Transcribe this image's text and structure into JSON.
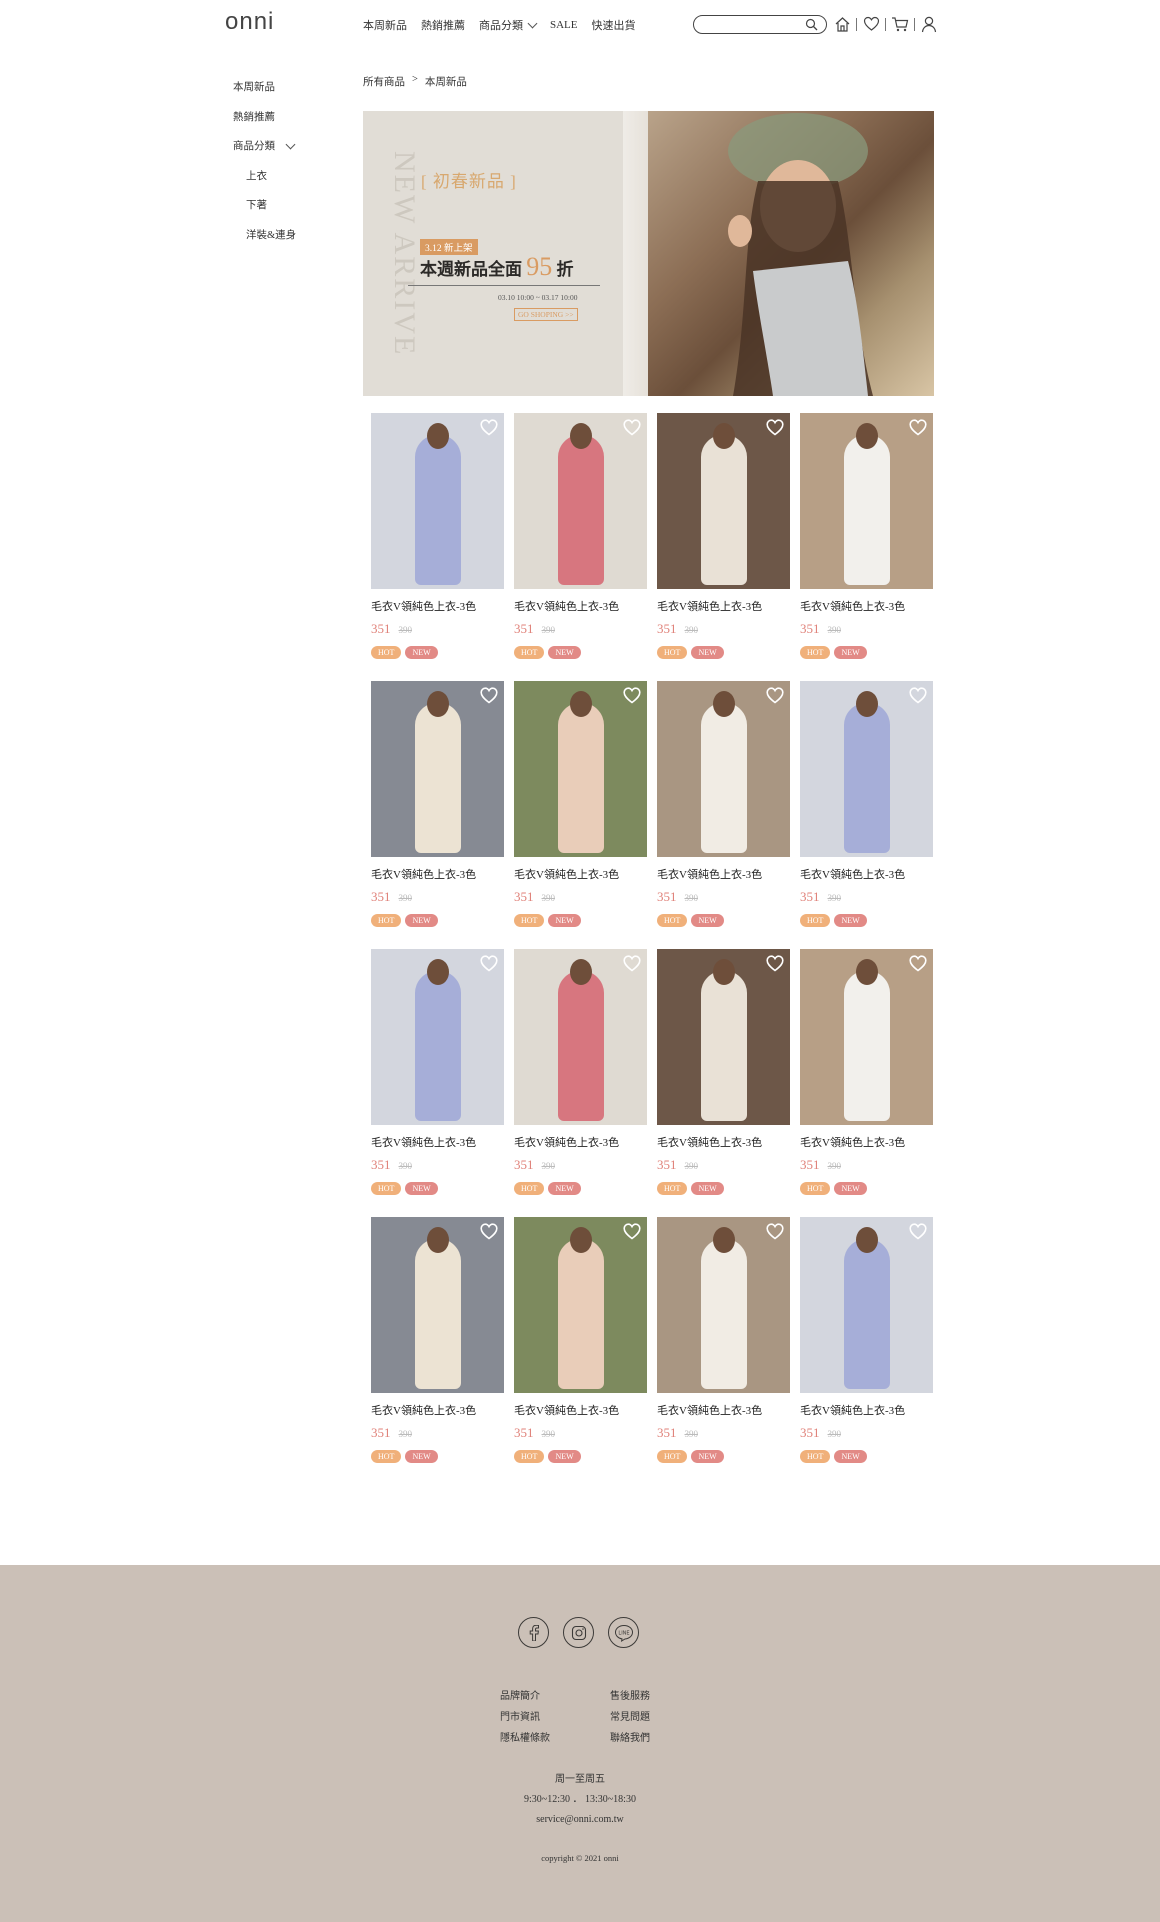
{
  "header": {
    "logo": "onni",
    "nav": [
      {
        "label": "本周新品",
        "dropdown": false
      },
      {
        "label": "熱銷推薦",
        "dropdown": false
      },
      {
        "label": "商品分類",
        "dropdown": true
      },
      {
        "label": "SALE",
        "dropdown": false
      },
      {
        "label": "快速出貨",
        "dropdown": false
      }
    ],
    "search_placeholder": "",
    "icons": [
      "home-icon",
      "heart-icon",
      "cart-icon",
      "user-icon"
    ]
  },
  "sidebar": {
    "items": [
      {
        "label": "本周新品",
        "sub": false
      },
      {
        "label": "熱銷推薦",
        "sub": false
      },
      {
        "label": "商品分類",
        "sub": false,
        "dropdown": true
      },
      {
        "label": "上衣",
        "sub": true
      },
      {
        "label": "下著",
        "sub": true
      },
      {
        "label": "洋裝&連身",
        "sub": true
      }
    ]
  },
  "breadcrumb": [
    "所有商品",
    ">",
    "本周新品"
  ],
  "banner": {
    "vertical_text": "NEW ARRIVE",
    "title": "[ 初春新品 ]",
    "tag": "3.12 新上架",
    "headline_pre": "本週新品全面",
    "headline_num": "95",
    "headline_post": "折",
    "dates": "03.10 10:00 ~ 03.17 10:00",
    "cta": "GO SHOPING >>"
  },
  "products": [
    {
      "name": "毛衣V領純色上衣-3色",
      "price": "351",
      "original": "390",
      "badges": [
        "HOT",
        "NEW"
      ],
      "bg": "#d3d6de",
      "dress": "#a6aed8"
    },
    {
      "name": "毛衣V領純色上衣-3色",
      "price": "351",
      "original": "390",
      "badges": [
        "HOT",
        "NEW"
      ],
      "bg": "#dfdad2",
      "dress": "#d7767f"
    },
    {
      "name": "毛衣V領純色上衣-3色",
      "price": "351",
      "original": "390",
      "badges": [
        "HOT",
        "NEW"
      ],
      "bg": "#6d5748",
      "dress": "#e9e1d6"
    },
    {
      "name": "毛衣V領純色上衣-3色",
      "price": "351",
      "original": "390",
      "badges": [
        "HOT",
        "NEW"
      ],
      "bg": "#b79f86",
      "dress": "#f2f0ec"
    },
    {
      "name": "毛衣V領純色上衣-3色",
      "price": "351",
      "original": "390",
      "badges": [
        "HOT",
        "NEW"
      ],
      "bg": "#868a93",
      "dress": "#ece3d3"
    },
    {
      "name": "毛衣V領純色上衣-3色",
      "price": "351",
      "original": "390",
      "badges": [
        "HOT",
        "NEW"
      ],
      "bg": "#7d8a5e",
      "dress": "#e9cdb9"
    },
    {
      "name": "毛衣V領純色上衣-3色",
      "price": "351",
      "original": "390",
      "badges": [
        "HOT",
        "NEW"
      ],
      "bg": "#a99682",
      "dress": "#f1ece4"
    },
    {
      "name": "毛衣V領純色上衣-3色",
      "price": "351",
      "original": "390",
      "badges": [
        "HOT",
        "NEW"
      ],
      "bg": "#d3d6de",
      "dress": "#a6aed8"
    },
    {
      "name": "毛衣V領純色上衣-3色",
      "price": "351",
      "original": "390",
      "badges": [
        "HOT",
        "NEW"
      ],
      "bg": "#d3d6de",
      "dress": "#a6aed8"
    },
    {
      "name": "毛衣V領純色上衣-3色",
      "price": "351",
      "original": "390",
      "badges": [
        "HOT",
        "NEW"
      ],
      "bg": "#dfdad2",
      "dress": "#d7767f"
    },
    {
      "name": "毛衣V領純色上衣-3色",
      "price": "351",
      "original": "390",
      "badges": [
        "HOT",
        "NEW"
      ],
      "bg": "#6d5748",
      "dress": "#e9e1d6"
    },
    {
      "name": "毛衣V領純色上衣-3色",
      "price": "351",
      "original": "390",
      "badges": [
        "HOT",
        "NEW"
      ],
      "bg": "#b79f86",
      "dress": "#f2f0ec"
    },
    {
      "name": "毛衣V領純色上衣-3色",
      "price": "351",
      "original": "390",
      "badges": [
        "HOT",
        "NEW"
      ],
      "bg": "#868a93",
      "dress": "#ece3d3"
    },
    {
      "name": "毛衣V領純色上衣-3色",
      "price": "351",
      "original": "390",
      "badges": [
        "HOT",
        "NEW"
      ],
      "bg": "#7d8a5e",
      "dress": "#e9cdb9"
    },
    {
      "name": "毛衣V領純色上衣-3色",
      "price": "351",
      "original": "390",
      "badges": [
        "HOT",
        "NEW"
      ],
      "bg": "#a99682",
      "dress": "#f1ece4"
    },
    {
      "name": "毛衣V領純色上衣-3色",
      "price": "351",
      "original": "390",
      "badges": [
        "HOT",
        "NEW"
      ],
      "bg": "#d3d6de",
      "dress": "#a6aed8"
    }
  ],
  "footer": {
    "social": [
      "facebook-icon",
      "instagram-icon",
      "line-icon"
    ],
    "links": [
      "品牌簡介",
      "售後服務",
      "門市資訊",
      "常見問題",
      "隱私權條款",
      "聯絡我們"
    ],
    "hours_days": "周一至周五",
    "hours_time": "9:30~12:30 ． 13:30~18:30",
    "email": "service@onni.com.tw",
    "copyright": "copyright © 2021 onni"
  },
  "colors": {
    "accent": "#d99b62",
    "price": "#e0827a",
    "hot": "#f0b07a",
    "new": "#e28a86",
    "footer_bg": "#cbc0b7"
  }
}
